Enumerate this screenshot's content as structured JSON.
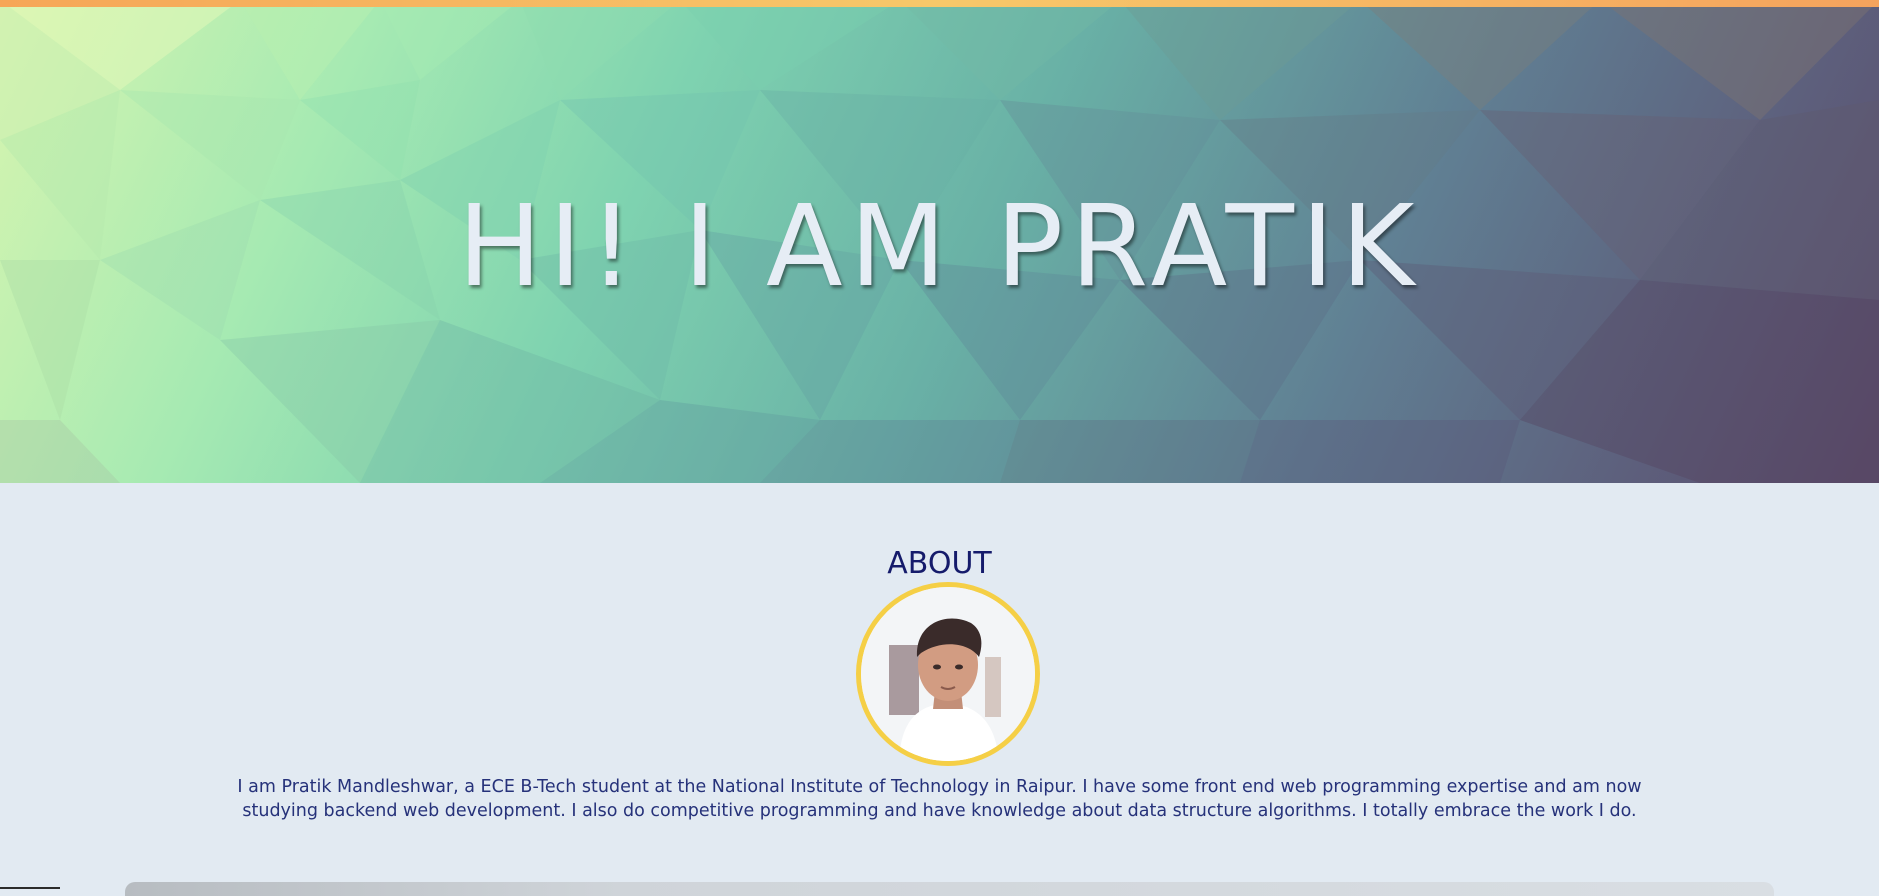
{
  "hero": {
    "title": "HI! I AM PRATIK"
  },
  "about": {
    "heading": "ABOUT",
    "avatar_alt": "profile-photo",
    "description": "I am Pratik Mandleshwar, a ECE B-Tech student at the National Institute of Technology in Raipur. I have some front end web programming expertise and am now studying backend web development. I also do competitive programming and have knowledge about data structure algorithms. I totally embrace the work I do."
  },
  "colors": {
    "heading": "#151b6b",
    "text": "#26327a",
    "avatar_border": "#f5cf46",
    "page_background": "#e2eaf2"
  }
}
